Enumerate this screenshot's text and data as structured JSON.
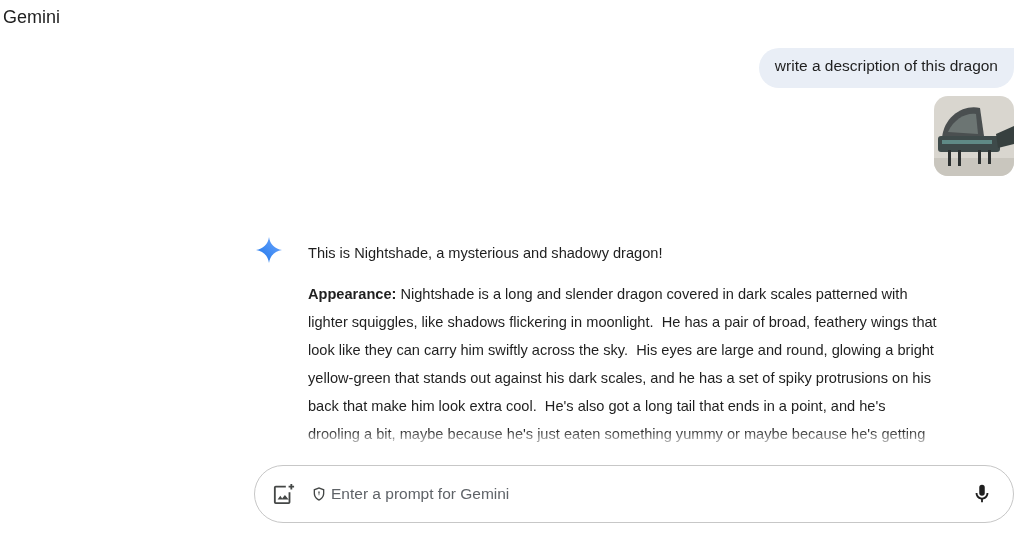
{
  "app_title": "Gemini",
  "user_message": {
    "text": "write a description of this dragon"
  },
  "response": {
    "intro": "This is Nightshade, a mysterious and shadowy dragon!",
    "paragraph_lines": [
      "**Appearance:** Nightshade is a long and slender dragon covered in dark scales patterned with",
      "lighter squiggles, like shadows flickering in moonlight.  He has a pair of broad, feathery wings that",
      "look like they can carry him swiftly across the sky.  His eyes are large and round, glowing a bright",
      "yellow-green that stands out against his dark scales, and he has a set of spiky protrusions on his",
      "back that make him look extra cool.  He's also got a long tail that ends in a point, and he's",
      "drooling a bit, maybe because he's just eaten something yummy or maybe because he's getting"
    ]
  },
  "prompt": {
    "placeholder": "Enter a prompt for Gemini"
  }
}
